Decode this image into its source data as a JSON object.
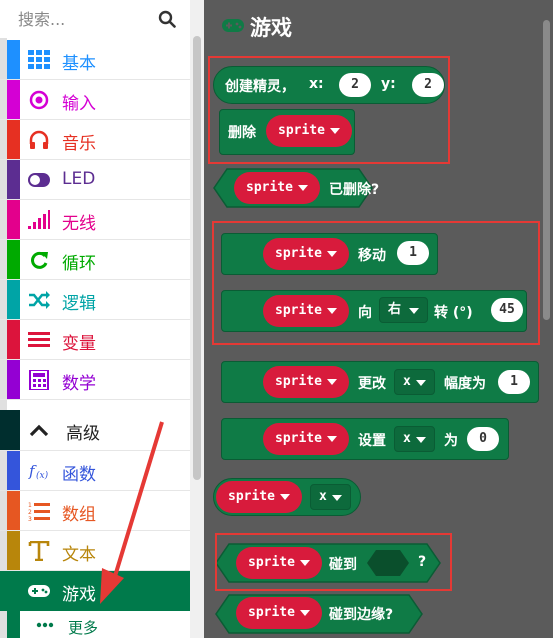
{
  "toolbox": {
    "search_placeholder": "搜索...",
    "categories": [
      {
        "label": "基本",
        "color": "#1e90ff",
        "icon": "grid-icon"
      },
      {
        "label": "输入",
        "color": "#d400d4",
        "icon": "target-icon"
      },
      {
        "label": "音乐",
        "color": "#e63022",
        "icon": "headphones-icon"
      },
      {
        "label": "LED",
        "color": "#5c2d91",
        "icon": "toggle-icon"
      },
      {
        "label": "无线",
        "color": "#e3008c",
        "icon": "signal-icon"
      },
      {
        "label": "循环",
        "color": "#00aa00",
        "icon": "refresh-icon"
      },
      {
        "label": "逻辑",
        "color": "#00a4a6",
        "icon": "shuffle-icon"
      },
      {
        "label": "变量",
        "color": "#dc143c",
        "icon": "list-icon"
      },
      {
        "label": "数学",
        "color": "#9400d3",
        "icon": "calculator-icon"
      },
      {
        "label": "高级",
        "color": "#002e2e",
        "icon": "chevron-up-icon"
      },
      {
        "label": "函数",
        "color": "#3455db",
        "icon": "function-icon"
      },
      {
        "label": "数组",
        "color": "#e65722",
        "icon": "array-icon"
      },
      {
        "label": "文本",
        "color": "#b8860b",
        "icon": "text-icon"
      },
      {
        "label": "游戏",
        "color": "#007a4b",
        "icon": "gamepad-icon"
      },
      {
        "label": "更多",
        "color": "#007a4b",
        "icon": "more-icon"
      }
    ]
  },
  "workspace": {
    "title": "游戏",
    "blocks": {
      "create": {
        "label": "创建精灵，",
        "x_label": "x:",
        "x_val": "2",
        "y_label": "y:",
        "y_val": "2"
      },
      "delete": {
        "label": "删除",
        "var": "sprite"
      },
      "deleted": {
        "var": "sprite",
        "label": "已删除?"
      },
      "move": {
        "var": "sprite",
        "label": "移动",
        "val": "1"
      },
      "turn": {
        "var": "sprite",
        "label": "向",
        "dir": "右",
        "label2": "转 (°)",
        "val": "45"
      },
      "change": {
        "var": "sprite",
        "label": "更改",
        "prop": "x",
        "label2": "幅度为",
        "val": "1"
      },
      "set": {
        "var": "sprite",
        "label": "设置",
        "prop": "x",
        "label2": "为",
        "val": "0"
      },
      "get": {
        "var": "sprite",
        "prop": "x"
      },
      "touching": {
        "var": "sprite",
        "label": "碰到",
        "q": "?"
      },
      "edge": {
        "var": "sprite",
        "label": "碰到边缘?"
      }
    }
  }
}
